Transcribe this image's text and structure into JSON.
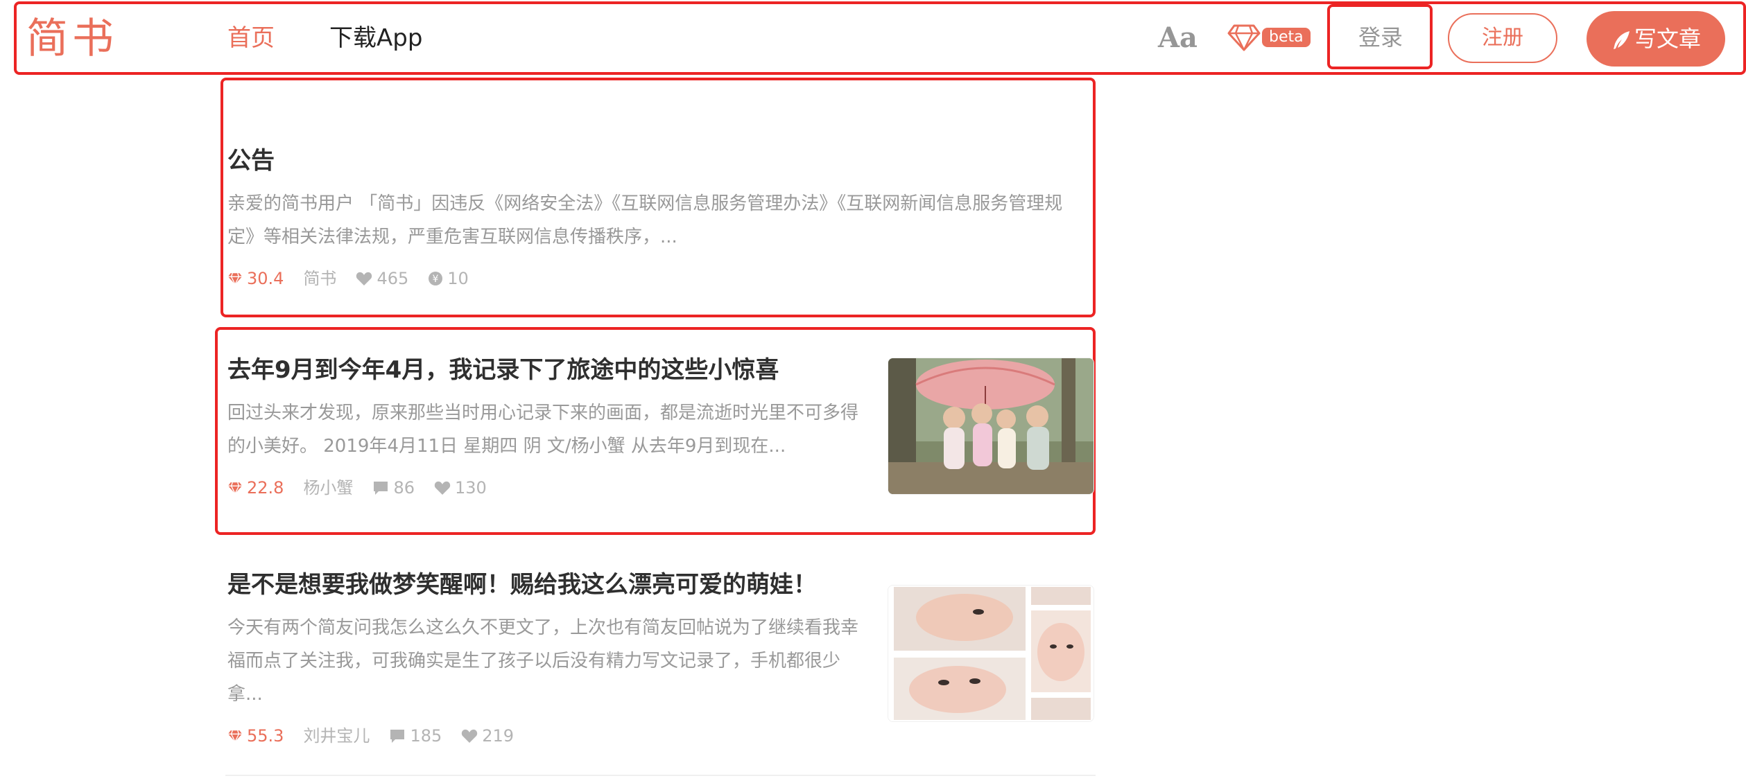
{
  "header": {
    "logo": "简书",
    "nav_home": "首页",
    "nav_app": "下载App",
    "font_toggle": "Aa",
    "beta_badge": "beta",
    "login": "登录",
    "register": "注册",
    "write": "写文章"
  },
  "colors": {
    "brand": "#ea6f5a",
    "highlight_box": "#ec2424"
  },
  "articles": [
    {
      "title": "公告",
      "abstract": "亲爱的简书用户 「简书」因违反《网络安全法》《互联网信息服务管理办法》《互联网新闻信息服务管理规定》等相关法律法规，严重危害互联网信息传播秩序，...",
      "paid": "30.4",
      "author": "简书",
      "likes": "465",
      "rewards": "10"
    },
    {
      "title": "去年9月到今年4月，我记录下了旅途中的这些小惊喜",
      "abstract": "回过头来才发现，原来那些当时用心记录下来的画面，都是流逝时光里不可多得的小美好。 2019年4月11日 星期四 阴 文/杨小蟹 从去年9月到现在...",
      "paid": "22.8",
      "author": "杨小蟹",
      "comments": "86",
      "likes": "130"
    },
    {
      "title": "是不是想要我做梦笑醒啊！赐给我这么漂亮可爱的萌娃！",
      "abstract": "今天有两个简友问我怎么这么久不更文了，上次也有简友回帖说为了继续看我幸福而点了关注我，可我确实是生了孩子以后没有精力写文记录了，手机都很少拿...",
      "paid": "55.3",
      "author": "刘井宝儿",
      "comments": "185",
      "likes": "219"
    }
  ]
}
